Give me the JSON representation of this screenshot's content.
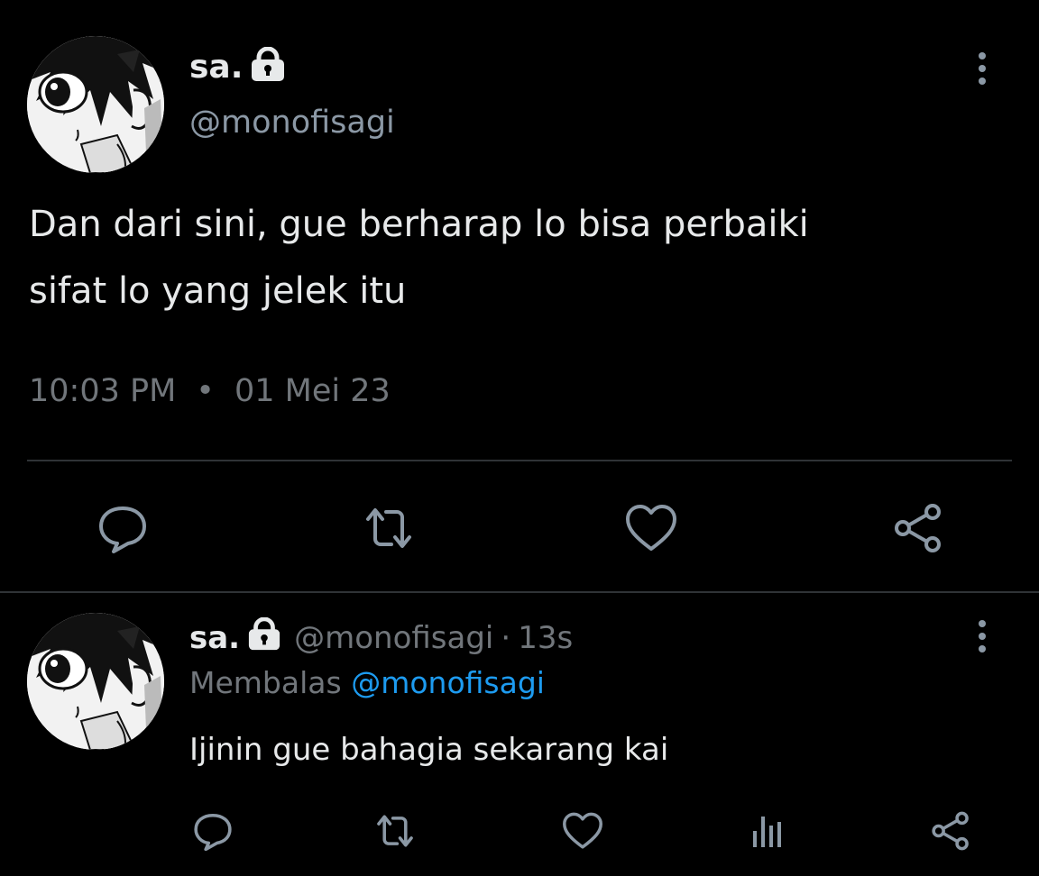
{
  "main_tweet": {
    "display_name": "sa.",
    "handle": "@monofisagi",
    "text_line1": "Dan dari sini, gue berharap lo bisa perbaiki",
    "text_line2": "sifat lo yang jelek itu",
    "time": "10:03 PM",
    "separator": "•",
    "date": "01 Mei 23"
  },
  "reply_tweet": {
    "display_name": "sa.",
    "handle": "@monofisagi",
    "separator": "·",
    "age": "13s",
    "replying_label": "Membalas",
    "replying_to": "@monofisagi",
    "text": "Ijinin gue bahagia sekarang kai"
  },
  "icons": {
    "lock": "lock-icon",
    "more": "more-vertical-icon",
    "reply": "comment-icon",
    "retweet": "retweet-icon",
    "like": "heart-icon",
    "share": "share-icon",
    "analytics": "analytics-icon"
  },
  "colors": {
    "background": "#000000",
    "text": "#e7e9ea",
    "muted": "#71767b",
    "link": "#1d9bf0",
    "divider": "#2f3336",
    "icon": "#8b98a5"
  }
}
